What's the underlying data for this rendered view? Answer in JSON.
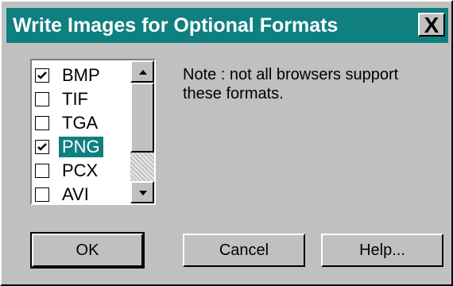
{
  "window": {
    "title": "Write Images for Optional Formats",
    "close_label": "X"
  },
  "formats": [
    {
      "label": "BMP",
      "checked": true,
      "selected": false
    },
    {
      "label": "TIF",
      "checked": false,
      "selected": false
    },
    {
      "label": "TGA",
      "checked": false,
      "selected": false
    },
    {
      "label": "PNG",
      "checked": true,
      "selected": true
    },
    {
      "label": "PCX",
      "checked": false,
      "selected": false
    },
    {
      "label": "AVI",
      "checked": false,
      "selected": false
    }
  ],
  "note": "Note : not all browsers support these formats.",
  "buttons": {
    "ok": "OK",
    "cancel": "Cancel",
    "help": "Help..."
  },
  "colors": {
    "titlebar": "#0f7f80",
    "face": "#c0c0c0"
  },
  "icons": {
    "close": "close-icon",
    "scroll_up": "arrow-up-icon",
    "scroll_down": "arrow-down-icon",
    "check": "checkmark-icon"
  }
}
